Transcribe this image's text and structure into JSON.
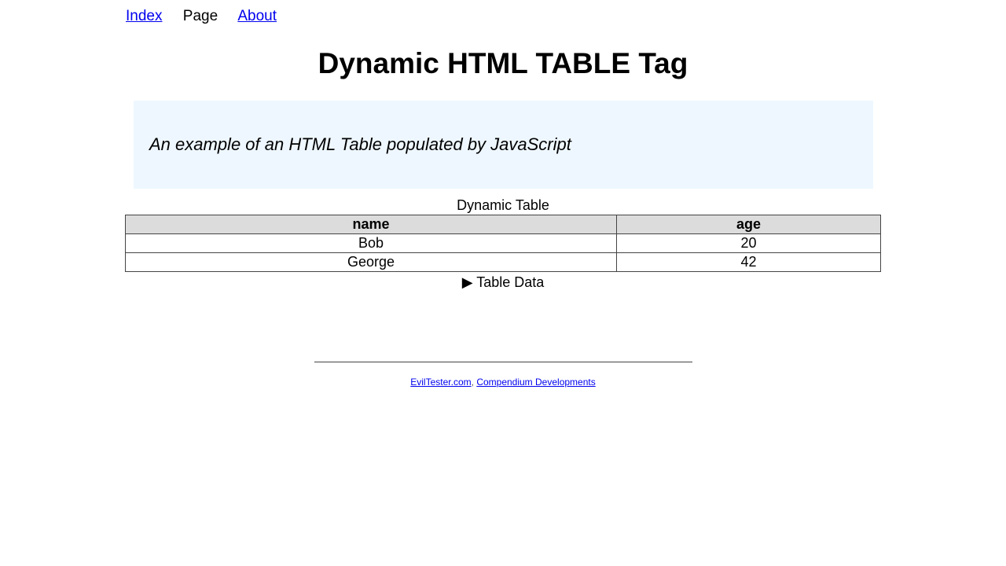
{
  "nav": {
    "index": "Index",
    "page": "Page",
    "about": "About"
  },
  "title": "Dynamic HTML TABLE Tag",
  "intro": "An example of an HTML Table populated by JavaScript",
  "table": {
    "caption": "Dynamic Table",
    "headers": [
      "name",
      "age"
    ],
    "rows": [
      [
        "Bob",
        "20"
      ],
      [
        "George",
        "42"
      ]
    ]
  },
  "details": {
    "marker": "▶",
    "summary": "Table Data"
  },
  "footer": {
    "link1": "EvilTester.com",
    "sep": ",",
    "link2": "Compendium Developments"
  }
}
